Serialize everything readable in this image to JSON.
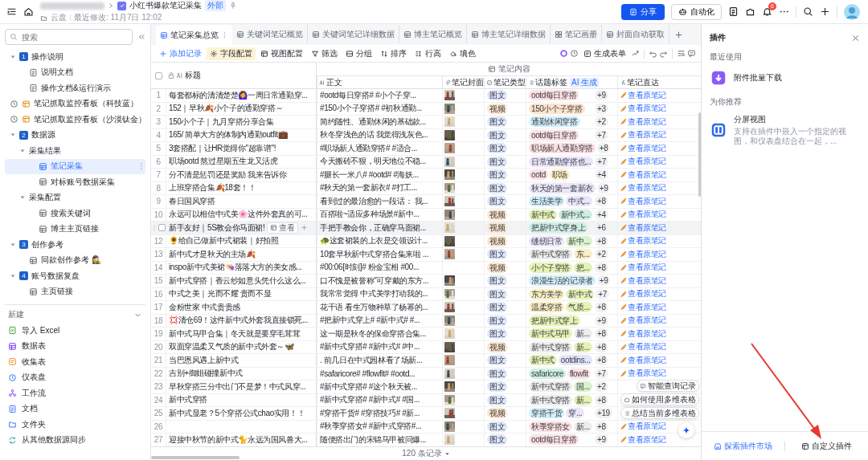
{
  "topbar": {
    "title": "小红书爆款笔记采集",
    "badge": "外部",
    "location": "云盘",
    "modified": "最近修改: 11月7日 12:02",
    "share": "分享",
    "automation": "自动化",
    "notifications": "6"
  },
  "sidebar": {
    "search_placeholder": "搜索",
    "items": [
      {
        "label": "操作说明",
        "kind": "section",
        "number": "1",
        "expanded": true,
        "selected": false,
        "children": [
          {
            "label": "说明文档",
            "kind": "doc",
            "selected": false
          },
          {
            "label": "操作文档&运行演示",
            "kind": "doc",
            "selected": false
          }
        ]
      },
      {
        "label": "笔记抓取监控看板（科技蓝）",
        "kind": "dashboard",
        "selected": false
      },
      {
        "label": "笔记抓取监控看板（沙漠钛金）",
        "kind": "dashboard",
        "selected": false
      },
      {
        "label": "数据源",
        "kind": "section",
        "number": "2",
        "expanded": true,
        "selected": false,
        "children": [
          {
            "label": "采集结果",
            "kind": "group",
            "expanded": true,
            "selected": false,
            "children": [
              {
                "label": "笔记采集",
                "kind": "table",
                "selected": true
              },
              {
                "label": "对标账号数据采集",
                "kind": "table",
                "selected": false
              }
            ]
          },
          {
            "label": "采集配置",
            "kind": "group",
            "expanded": true,
            "selected": false,
            "children": [
              {
                "label": "搜索关键词",
                "kind": "table",
                "selected": false
              },
              {
                "label": "博主主页链接",
                "kind": "table",
                "selected": false
              }
            ]
          }
        ]
      },
      {
        "label": "创作参考",
        "kind": "section",
        "number": "3",
        "expanded": true,
        "selected": false,
        "children": [
          {
            "label": "同款创作参考 🕵️‍♀️",
            "kind": "table",
            "selected": false
          }
        ]
      },
      {
        "label": "账号数据复盘",
        "kind": "section",
        "number": "4",
        "expanded": true,
        "selected": false,
        "children": [
          {
            "label": "主页链接",
            "kind": "table",
            "selected": false
          }
        ]
      }
    ],
    "new_section": {
      "label": "新建",
      "expanded": true,
      "items": [
        {
          "label": "导入 Excel",
          "kind": "excel"
        },
        {
          "label": "数据表",
          "kind": "table"
        },
        {
          "label": "收集表",
          "kind": "form"
        },
        {
          "label": "仪表盘",
          "kind": "dashboard"
        },
        {
          "label": "工作流",
          "kind": "workflow"
        },
        {
          "label": "文档",
          "kind": "doc"
        },
        {
          "label": "文件夹",
          "kind": "folder"
        },
        {
          "label": "从其他数据源同步",
          "kind": "sync"
        }
      ]
    }
  },
  "tabs": [
    {
      "label": "笔记采集总览",
      "kind": "table",
      "selected": true
    },
    {
      "label": "关键词笔记概览",
      "kind": "table",
      "selected": false
    },
    {
      "label": "关键词笔记详细数据",
      "kind": "table",
      "selected": false
    },
    {
      "label": "博主笔记概览",
      "kind": "table",
      "selected": false
    },
    {
      "label": "博主笔记详细数据",
      "kind": "table",
      "selected": false
    },
    {
      "label": "笔记画册",
      "kind": "gallery",
      "selected": false
    },
    {
      "label": "封面自动获取",
      "kind": "table",
      "selected": false
    }
  ],
  "toolbar": {
    "left": [
      {
        "label": "添加记录",
        "kind": "add",
        "selected": false
      },
      {
        "label": "字段配置",
        "kind": "fields",
        "selected": true
      },
      {
        "label": "视图配置",
        "kind": "view",
        "selected": false
      },
      {
        "label": "筛选",
        "kind": "filter",
        "selected": false
      },
      {
        "label": "分组",
        "kind": "group",
        "selected": false
      },
      {
        "label": "排序",
        "kind": "sort",
        "selected": false
      },
      {
        "label": "行高",
        "kind": "height",
        "selected": false
      },
      {
        "label": "填色",
        "kind": "fill",
        "selected": false
      }
    ],
    "generate_form": "生成表单"
  },
  "table": {
    "group_header": "笔记内容",
    "columns": [
      {
        "label": "标题"
      },
      {
        "label": "正文"
      },
      {
        "label": "笔记封面"
      },
      {
        "label": "笔记类型"
      },
      {
        "label": "话题标签",
        "badge": "AI 生成"
      },
      {
        "label": "笔记直达"
      }
    ],
    "rows": [
      {
        "number": "1",
        "title": "每套都标的清清楚楚🙆‍♀️一周日常通勤穿...",
        "body": "#ootd每日穿搭# #小个子穿...",
        "cover": true,
        "type": {
          "label": "图文",
          "color": "#dfe7fb"
        },
        "tags": [
          {
            "label": "ootd每日穿搭",
            "color": "#fde0e3"
          }
        ],
        "more": "+9",
        "link": "查看原笔记",
        "hovered": false
      },
      {
        "number": "2",
        "title": "152｜早秋🍂小个子的通勤穿搭～",
        "body": "#150小个子穿搭# #初秋通勤...",
        "cover": true,
        "type": {
          "label": "视频",
          "color": "#fde4cb"
        },
        "tags": [
          {
            "label": "150小个子穿搭",
            "color": "#fde4cb"
          }
        ],
        "more": "+3",
        "link": "查看原笔记",
        "hovered": false
      },
      {
        "number": "3",
        "title": "150小个子｜九月穿搭分享合集",
        "body": "简约随性、通勤休闲的基础款...",
        "cover": true,
        "type": {
          "label": "图文",
          "color": "#dfe7fb"
        },
        "tags": [
          {
            "label": "通勤休闲穿搭",
            "color": "#d3eefa"
          }
        ],
        "more": "+2",
        "link": "查看原笔记",
        "hovered": false
      },
      {
        "number": "4",
        "title": "165/ 简单大方的体制内通勤outfit💼",
        "body": "秋冬穿浅色的话 我觉得浅灰色...",
        "cover": true,
        "type": {
          "label": "图文",
          "color": "#dfe7fb"
        },
        "tags": [
          {
            "label": "ootd每日穿搭",
            "color": "#fde0e3"
          }
        ],
        "more": "+7",
        "link": "查看原笔记",
        "hovered": false
      },
      {
        "number": "5",
        "title": "3套搭配｜让HR觉得你\"超靠谱\"!",
        "body": "#职场新人通勤穿搭# #适合...",
        "cover": true,
        "type": {
          "label": "图文",
          "color": "#dfe7fb"
        },
        "tags": [
          {
            "label": "职场新人通勤穿搭",
            "color": "#fde0e3"
          }
        ],
        "more": "+8",
        "link": "查看原笔记",
        "hovered": false
      },
      {
        "number": "6",
        "title": "职场ootd 熬过星期五生龙又活虎",
        "body": "今天搬砖不狠，明天地位不稳...",
        "cover": true,
        "type": {
          "label": "图文",
          "color": "#dfe7fb"
        },
        "tags": [
          {
            "label": "日常通勤穿搭也...",
            "color": "#ebe5fa"
          }
        ],
        "more": "+7",
        "link": "查看原笔记",
        "hovered": false
      },
      {
        "number": "7",
        "title": "分不清是惩罚还是奖励 我来告诉你",
        "body": "#腿长一米八# #ootd# #海妖...",
        "cover": true,
        "type": {
          "label": "图文",
          "color": "#dfe7fb"
        },
        "tags": [
          {
            "label": "ootd",
            "color": "#fde0e3"
          },
          {
            "label": "职场",
            "color": "#fbefc4"
          }
        ],
        "more": "+4",
        "link": "查看原笔记",
        "hovered": false
      },
      {
        "number": "8",
        "title": "上班穿搭合集🍂18套！！",
        "body": "#秋天的第一套新衣# #打工...",
        "cover": true,
        "type": {
          "label": "图文",
          "color": "#dfe7fb"
        },
        "tags": [
          {
            "label": "秋天的第一套新衣",
            "color": "#ebe5fa"
          }
        ],
        "more": "+9",
        "link": "查看原笔记",
        "hovered": false
      },
      {
        "number": "9",
        "title": "春日国风穿搭",
        "body": "看到过的最治愈的一段话： 我...",
        "cover": true,
        "type": {
          "label": "图文",
          "color": "#dfe7fb"
        },
        "tags": [
          {
            "label": "生活美学",
            "color": "#d3eefa"
          },
          {
            "label": "中式...",
            "color": "#ebe5fa"
          }
        ],
        "more": "+8",
        "link": "查看原笔记",
        "hovered": false
      },
      {
        "number": "10",
        "title": "永远可以相信中式美🌸这件外套真的可...",
        "body": "百搭啦~适应多种场景#新中...",
        "cover": true,
        "type": {
          "label": "视频",
          "color": "#fde4cb"
        },
        "tags": [
          {
            "label": "新中式",
            "color": "#e5f2b5"
          },
          {
            "label": "新中式...",
            "color": "#d0efe4"
          }
        ],
        "more": "+4",
        "link": "查看原笔记",
        "hovered": false
      },
      {
        "title": "新手友好｜5S教会你马面裙!",
        "open_button": "查看",
        "body": "手把手教会你，正确穿马面裙...",
        "cover": true,
        "type": {
          "label": "视频",
          "color": "#fde4cb"
        },
        "tags": [
          {
            "label": "把新中式穿身上",
            "color": "#d0efe4"
          }
        ],
        "more": "+6",
        "link": "查看原笔记",
        "hovered": true
      },
      {
        "number": "12",
        "title": "🌻给自己做新中式裙装｜好拍照",
        "body": "🐢这套裙装的上衣是交领设计...",
        "cover": true,
        "type": {
          "label": "视频",
          "color": "#fde4cb"
        },
        "tags": [
          {
            "label": "缝纫日常",
            "color": "#ebe5fa"
          },
          {
            "label": "新中...",
            "color": "#d9f2cc"
          }
        ],
        "more": "+8",
        "link": "查看原笔记",
        "hovered": false
      },
      {
        "number": "13",
        "title": "新中式才是秋天的主场🍂",
        "body": "10套早秋新中式穿搭合集来啦 ...",
        "cover": true,
        "type": {
          "label": "图文",
          "color": "#dfe7fb"
        },
        "tags": [
          {
            "label": "新中式穿搭",
            "color": "#ededed"
          },
          {
            "label": "东...",
            "color": "#fbefc4"
          }
        ],
        "more": "+2",
        "link": "查看原笔记",
        "hovered": false
      },
      {
        "number": "14",
        "title": "inspo新中式美裙👒落落大方的美女感...",
        "body": "#00:06[时刻]# 粉金宝相 #00...",
        "cover": false,
        "type": {
          "label": "视频",
          "color": "#fde4cb"
        },
        "tags": [
          {
            "label": "小个子穿搭",
            "color": "#e5f2b5"
          },
          {
            "label": "把...",
            "color": "#e5f2b5"
          }
        ],
        "more": "+8",
        "link": "查看原笔记",
        "hovered": false
      },
      {
        "number": "15",
        "title": "新中式穿搭｜香云纱如意头凭什么这么...",
        "body": "口不愧是被誉称\"可穿戴的东方...",
        "cover": true,
        "type": {
          "label": "图文",
          "color": "#dfe7fb"
        },
        "tags": [
          {
            "label": "浪漫生活的记录者",
            "color": "#d3eefa"
          }
        ],
        "more": "+9",
        "link": "查看原笔记",
        "hovered": false
      },
      {
        "number": "16",
        "title": "中式之美｜光而不耀 贵而不显",
        "body": "我常常觉得 中式美学打动我的...",
        "cover": true,
        "type": {
          "label": "图文",
          "color": "#dfe7fb"
        },
        "tags": [
          {
            "label": "东方美学",
            "color": "#fbefc4"
          },
          {
            "label": "新中式",
            "color": "#e5f2b5"
          }
        ],
        "more": "+7",
        "link": "查看原笔记",
        "hovered": false
      },
      {
        "number": "17",
        "title": "金粉世家 中式贵贵感",
        "body": "花千语 看生万物种草了杨幂的...",
        "cover": true,
        "type": {
          "label": "图文",
          "color": "#dfe7fb"
        },
        "tags": [
          {
            "label": "温柔穿搭",
            "color": "#fbefc4"
          },
          {
            "label": "气质...",
            "color": "#e5f2b5"
          }
        ],
        "more": "+8",
        "link": "查看原笔记",
        "hovered": false
      },
      {
        "number": "18",
        "title": "💢清仓69！这件新中式外套我直接锁死...",
        "body": "#把新中式穿上# #新中式# #...",
        "cover": true,
        "type": {
          "label": "图文",
          "color": "#dfe7fb"
        },
        "tags": [
          {
            "label": "把新中式穿上",
            "color": "#e5f2b5"
          }
        ],
        "more": "+9",
        "link": "查看原笔记",
        "hovered": false
      },
      {
        "number": "19",
        "title": "新中式马甲合集｜冬天就是要穿毛茸茸",
        "body": "这一期是秋冬的保命穿搭合集...",
        "cover": true,
        "type": {
          "label": "图文",
          "color": "#dfe7fb"
        },
        "tags": [
          {
            "label": "新中式马甲",
            "color": "#e5f2b5"
          },
          {
            "label": "新...",
            "color": "#ededed"
          }
        ],
        "more": "+8",
        "link": "查看原笔记",
        "hovered": false
      },
      {
        "number": "20",
        "title": "双面穿温柔又气质的新中式外套～🦋",
        "body": "#新中式穿搭# #新中式# #中...",
        "cover": true,
        "type": {
          "label": "视频",
          "color": "#fde4cb"
        },
        "tags": [
          {
            "label": "新中式穿搭",
            "color": "#ededed"
          },
          {
            "label": "新...",
            "color": "#e5f2b5"
          }
        ],
        "more": "+8",
        "link": "查看原笔记",
        "hovered": false
      },
      {
        "number": "21",
        "title": "当巴恩风遇上新中式",
        "body": ". 前几日在中式园林看了场新...",
        "cover": true,
        "type": {
          "label": "图文",
          "color": "#dfe7fb"
        },
        "tags": [
          {
            "label": "新中式",
            "color": "#e5f2b5"
          },
          {
            "label": "ootdins...",
            "color": "#e2e5fb"
          }
        ],
        "more": "+8",
        "link": "查看原笔记",
        "hovered": false
      },
      {
        "number": "22",
        "title": "吉别+御姐碰撞新中式",
        "body": "#safaricore# #flowfit# #ootd...",
        "cover": true,
        "type": {
          "label": "图文",
          "color": "#dfe7fb"
        },
        "tags": [
          {
            "label": "safaricore",
            "color": "#d0efe4"
          },
          {
            "label": "flowfit",
            "color": "#fde0e3"
          }
        ],
        "more": "+7",
        "link": "查看原笔记",
        "hovered": false
      },
      {
        "number": "23",
        "title": "早秋穿搭三分中出门不是梦！中式风穿...",
        "body": "#新中式穿搭# #这个秋天被...",
        "cover": true,
        "type": {
          "label": "图文",
          "color": "#dfe7fb"
        },
        "tags": [
          {
            "label": "新中式穿搭",
            "color": "#ededed"
          },
          {
            "label": "国...",
            "color": "#d9f2cc"
          }
        ],
        "more": "+2",
        "hovered": false
      },
      {
        "number": "24",
        "title": "新中式穿搭",
        "body": "#新中式穿搭# #新中式# #国...",
        "cover": true,
        "type": {
          "label": "图文",
          "color": "#dfe7fb"
        },
        "tags": [
          {
            "label": "新中式穿搭",
            "color": "#ededed"
          },
          {
            "label": "新...",
            "color": "#e5f2b5"
          }
        ],
        "more": "+8",
        "hovered": false
      },
      {
        "number": "25",
        "title": "新中式显老？5个穿搭公式chao实用！！",
        "body": "#穿搭干货# #穿搭技巧# #新...",
        "cover": true,
        "type": {
          "label": "视频",
          "color": "#fde4cb"
        },
        "tags": [
          {
            "label": "穿搭干货",
            "color": "#d3eefa"
          },
          {
            "label": "穿...",
            "color": "#ebe5fa"
          }
        ],
        "more": "+19",
        "hovered": false
      },
      {
        "number": "26",
        "body": "#秋季穿搭女# #新中式穿搭#...",
        "cover": true,
        "type": {
          "label": "图文",
          "color": "#dfe7fb"
        },
        "tags": [
          {
            "label": "秋季穿搭女",
            "color": "#fde0e3"
          },
          {
            "label": "新...",
            "color": "#ededed"
          }
        ],
        "more": "+8",
        "link": "查看原笔记",
        "hovered": false
      },
      {
        "number": "27",
        "title": "迎接中秋节的新中式🐈永远为国风兽大...",
        "body": "随便搭出门的宋锦马甲被问爆...",
        "cover": true,
        "type": {
          "label": "图文",
          "color": "#dfe7fb"
        },
        "tags": [
          {
            "label": "ootd每日穿搭",
            "color": "#fde0e3"
          }
        ],
        "more": "+9",
        "link": "查看原笔记",
        "hovered": false
      }
    ],
    "record_count": "120 条记录",
    "select_all_checked": false
  },
  "assistant": {
    "suggestions": [
      "智能查询记录",
      "如何使用多维表格",
      "总结当前多维表格"
    ]
  },
  "plugin_panel": {
    "title": "插件",
    "recent_label": "最近使用",
    "recent": [
      {
        "name": "附件批量下载"
      }
    ],
    "recommend_label": "为你推荐",
    "recommended": [
      {
        "name": "分屏视图",
        "description": "支持在插件中嵌入一个指定的视图，和仪表盘结合在一起，..."
      }
    ],
    "explore": "探索插件市场",
    "custom": "自定义插件"
  }
}
